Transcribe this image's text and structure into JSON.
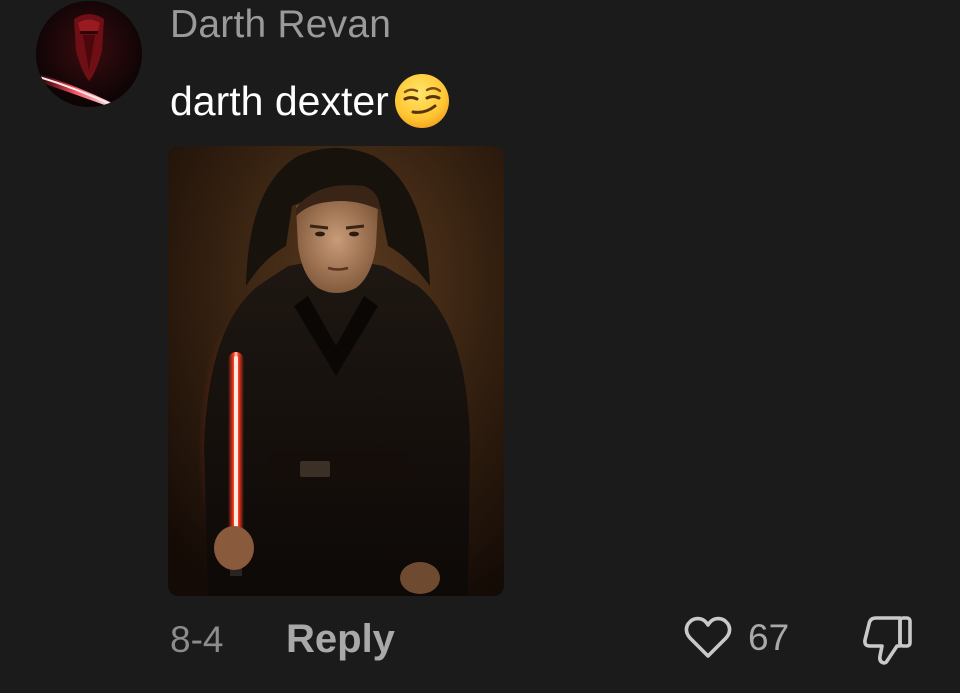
{
  "comment": {
    "username": "Darth Revan",
    "text": "darth dexter",
    "emoji": "smirking-face-emoji",
    "date": "8-4",
    "reply_label": "Reply",
    "like_count": "67"
  },
  "icons": {
    "like": "heart-outline-icon",
    "dislike": "thumbs-down-icon"
  },
  "colors": {
    "background": "#1b1b1b",
    "username": "#9a9a9a",
    "text": "#ffffff",
    "meta": "#a9a9a9",
    "lightsaber": "#ff3b1f"
  }
}
